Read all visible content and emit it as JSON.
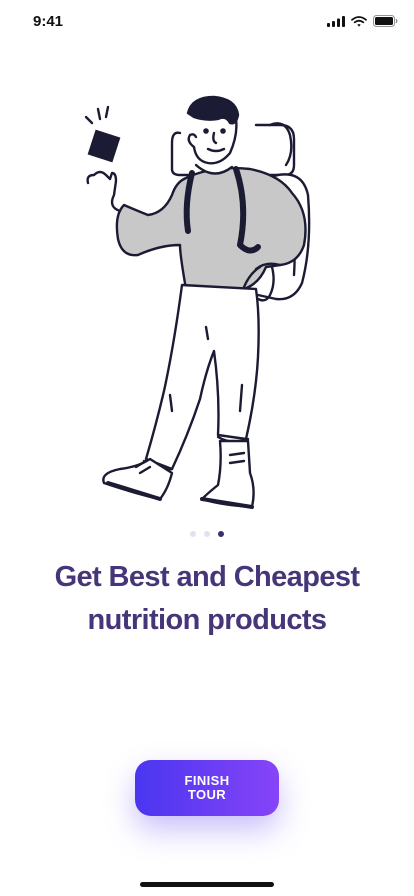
{
  "status_bar": {
    "time": "9:41",
    "icons": [
      "signal-icon",
      "wifi-icon",
      "battery-icon"
    ]
  },
  "illustration": {
    "name": "hiker-with-backpack"
  },
  "pager": {
    "total": 3,
    "active": 3
  },
  "onboarding": {
    "headline": "Get Best and Cheapest nutrition products",
    "cta_label": "FINISH TOUR"
  },
  "colors": {
    "headline": "#463679",
    "cta_gradient_start": "#4a36f0",
    "cta_gradient_end": "#8744f7",
    "dot_active": "#3a2f6b",
    "dot_inactive": "#e4e1ef"
  }
}
